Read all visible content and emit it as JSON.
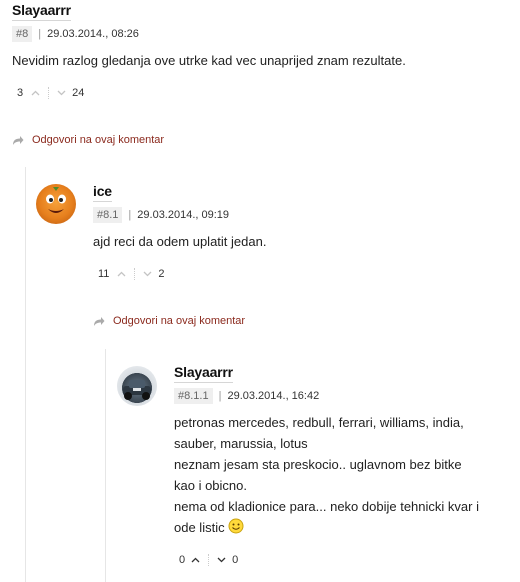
{
  "comments": [
    {
      "author": "Slayaarrr",
      "number": "#8",
      "separator": "|",
      "date": "29.03.2014., 08:26",
      "lines": [
        "Nevidim razlog gledanja ove utrke kad vec unaprijed znam rezultate."
      ],
      "upvotes": "3",
      "downvotes": "24",
      "reply_label": "Odgovori na ovaj komentar"
    },
    {
      "author": "ice",
      "number": "#8.1",
      "separator": "|",
      "date": "29.03.2014., 09:19",
      "lines": [
        "ajd reci da odem uplatit jedan."
      ],
      "upvotes": "11",
      "downvotes": "2",
      "reply_label": "Odgovori na ovaj komentar"
    },
    {
      "author": "Slayaarrr",
      "number": "#8.1.1",
      "separator": "|",
      "date": "29.03.2014., 16:42",
      "lines": [
        "petronas mercedes, redbull, ferrari, williams, india,",
        "sauber, marussia, lotus",
        "neznam jesam sta preskocio.. uglavnom bez bitke",
        "kao i obicno.",
        "nema od kladionice para... neko dobije tehnicki kvar i",
        "ode listic"
      ],
      "upvotes": "0",
      "downvotes": "0"
    }
  ],
  "icons": {
    "upvote": "chevron-up-icon",
    "downvote": "chevron-down-icon",
    "reply": "reply-arrow-icon",
    "smiley": "smiley-icon"
  },
  "colors": {
    "reply_link": "#8b2a1e",
    "badge_bg": "#efefef",
    "thread_line": "#e6e6e6"
  }
}
